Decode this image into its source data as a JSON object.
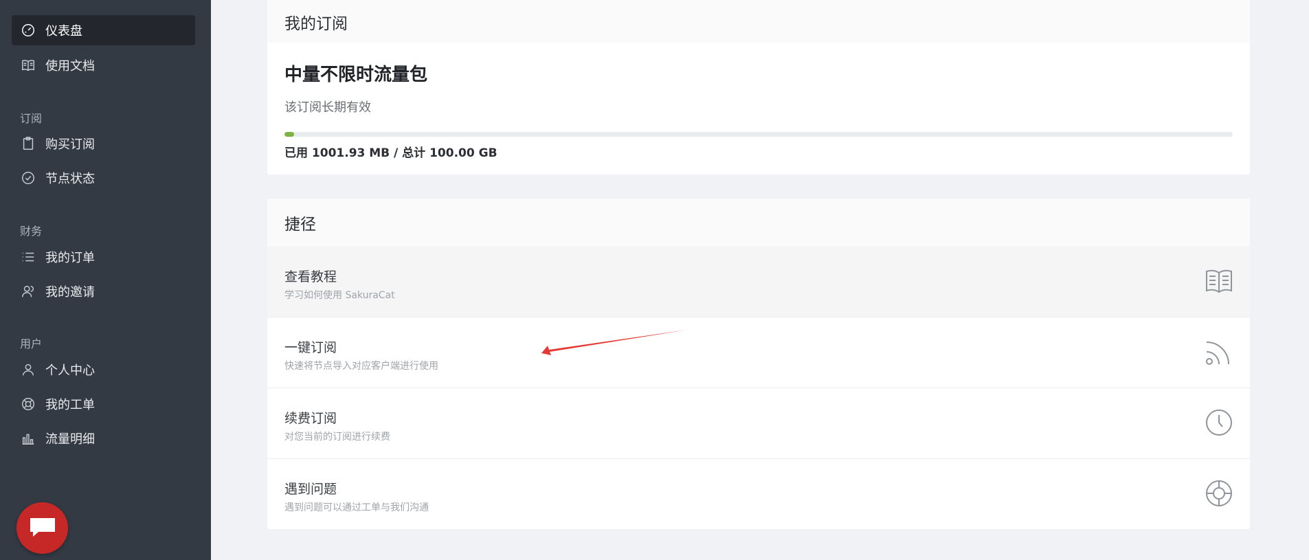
{
  "sidebar": {
    "items": [
      {
        "label": "仪表盘",
        "icon": "dashboard-icon",
        "active": true
      },
      {
        "label": "使用文档",
        "icon": "book-icon"
      }
    ],
    "sections": [
      {
        "title": "订阅",
        "items": [
          {
            "label": "购买订阅",
            "icon": "clipboard-icon"
          },
          {
            "label": "节点状态",
            "icon": "check-circle-icon"
          }
        ]
      },
      {
        "title": "财务",
        "items": [
          {
            "label": "我的订单",
            "icon": "list-icon"
          },
          {
            "label": "我的邀请",
            "icon": "users-icon"
          }
        ]
      },
      {
        "title": "用户",
        "items": [
          {
            "label": "个人中心",
            "icon": "user-icon"
          },
          {
            "label": "我的工单",
            "icon": "lifebuoy-icon"
          },
          {
            "label": "流量明细",
            "icon": "bar-chart-icon"
          }
        ]
      }
    ],
    "chat_icon": "chat-icon"
  },
  "subscription": {
    "header": "我的订阅",
    "plan_name": "中量不限时流量包",
    "validity": "该订阅长期有效",
    "usage_text": "已用 1001.93 MB / 总计 100.00 GB",
    "usage_fraction": 0.0098
  },
  "shortcuts": {
    "header": "捷径",
    "items": [
      {
        "title": "查看教程",
        "subtitle": "学习如何使用 SakuraCat",
        "icon": "book-open-icon"
      },
      {
        "title": "一键订阅",
        "subtitle": "快速将节点导入对应客户端进行使用",
        "icon": "rss-icon"
      },
      {
        "title": "续费订阅",
        "subtitle": "对您当前的订阅进行续费",
        "icon": "clock-icon"
      },
      {
        "title": "遇到问题",
        "subtitle": "遇到问题可以通过工单与我们沟通",
        "icon": "lifebuoy-icon"
      }
    ]
  },
  "colors": {
    "sidebar_bg": "#343a44",
    "progress": "#7cb342",
    "chat_fab": "#c62828",
    "arrow": "#e53935"
  }
}
